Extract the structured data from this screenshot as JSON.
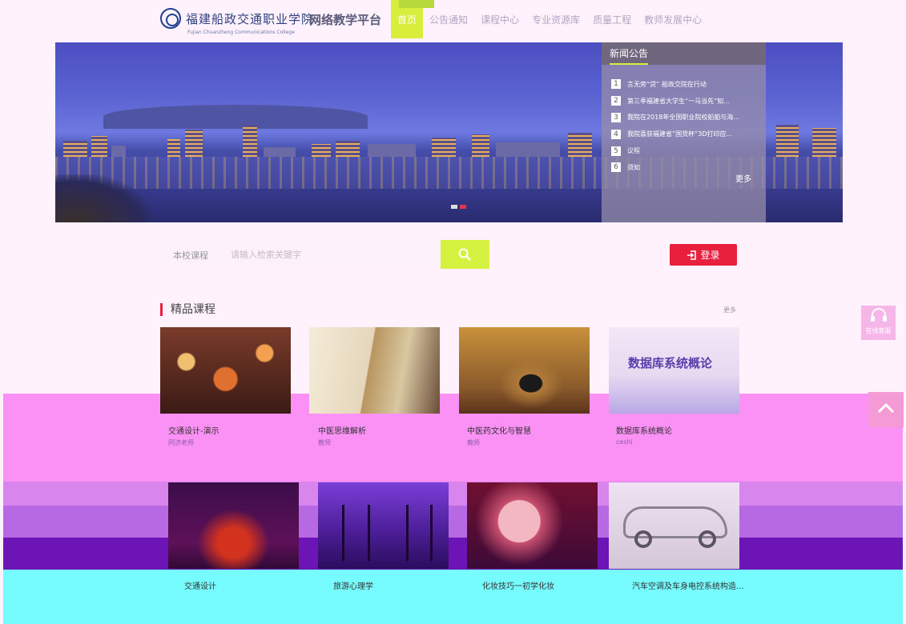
{
  "header": {
    "logo_text": "福建船政交通职业学院",
    "logo_subtitle": "Fujian Chuanzheng Communications College",
    "platform_title": "网络教学平台",
    "nav": [
      {
        "label": "首页",
        "active": true
      },
      {
        "label": "公告通知",
        "active": false
      },
      {
        "label": "课程中心",
        "active": false
      },
      {
        "label": "专业资源库",
        "active": false
      },
      {
        "label": "质量工程",
        "active": false
      },
      {
        "label": "教师发展中心",
        "active": false
      }
    ]
  },
  "banner": {
    "slide_count": 2,
    "active_slide": 2
  },
  "news": {
    "title": "新闻公告",
    "items": [
      {
        "num": "1",
        "text": "言无旁“贷” 船政交院在行动"
      },
      {
        "num": "2",
        "text": "第三季福建省大学生“一马当先”知..."
      },
      {
        "num": "3",
        "text": "我院在2018年全国职业院校船舶与海..."
      },
      {
        "num": "4",
        "text": "我院喜获福建省“国货杯”3D打印应..."
      },
      {
        "num": "5",
        "text": "议程"
      },
      {
        "num": "6",
        "text": "须知"
      }
    ],
    "more": "更多"
  },
  "search": {
    "scope": "本校课程",
    "placeholder": "请输入检索关键字",
    "icon": "search-icon"
  },
  "login": {
    "label": "登录",
    "icon": "login-icon"
  },
  "courses_section": {
    "title": "精品课程",
    "more": "更多",
    "courses": [
      {
        "name": "交通设计-演示",
        "teacher": "同济老师"
      },
      {
        "name": "中医思维解析",
        "teacher": "教师"
      },
      {
        "name": "中医药文化与智慧",
        "teacher": "教师"
      },
      {
        "name": "数据库系统概论",
        "teacher": "ceshi",
        "thumb_text": "数据库系统概论"
      },
      {
        "name": "交通设计",
        "teacher": ""
      },
      {
        "name": "旅游心理学",
        "teacher": ""
      },
      {
        "name": "化妆技巧一初学化妆",
        "teacher": ""
      },
      {
        "name": "汽车空调及车身电控系统构造...",
        "teacher": ""
      }
    ]
  },
  "side_widgets": {
    "customer_service": {
      "label": "在线客服",
      "icon": "headset-icon"
    },
    "back_to_top": {
      "icon": "chevron-up-icon"
    }
  },
  "colors": {
    "accent_green": "#d4f23f",
    "login_red": "#e8203e",
    "section_marker": "#e8203e"
  }
}
